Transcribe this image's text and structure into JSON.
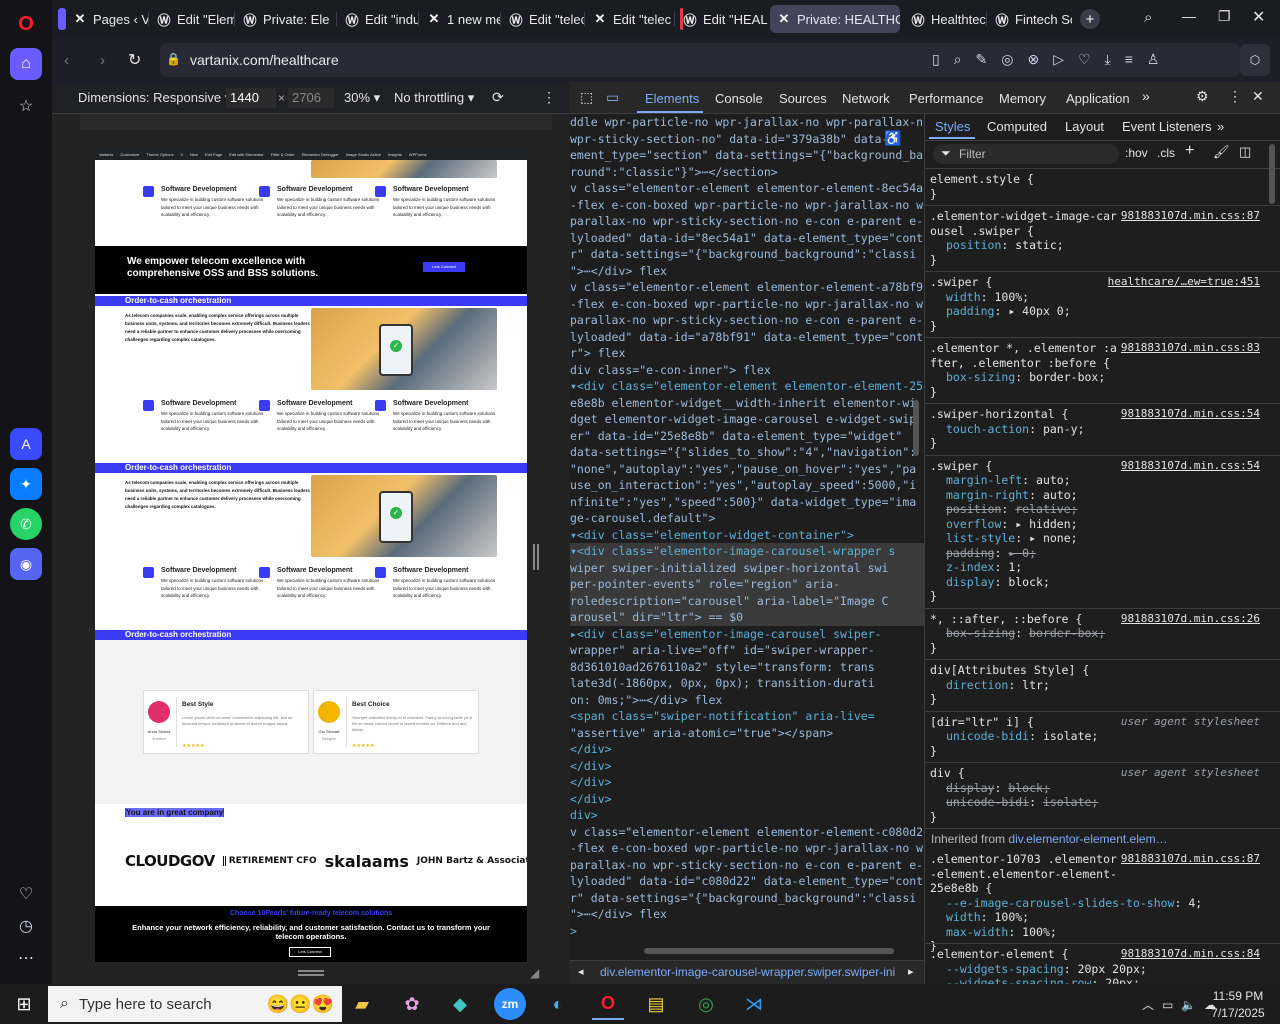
{
  "browser": {
    "tabs": [
      {
        "label": "Pages ‹ Va",
        "icon": "x-icon"
      },
      {
        "label": "Edit \"Elem",
        "icon": "wordpress-icon"
      },
      {
        "label": "Private: Ele",
        "icon": "wordpress-icon"
      },
      {
        "label": "Edit \"indus",
        "icon": "wordpress-icon"
      },
      {
        "label": "1 new mes",
        "icon": "x-icon"
      },
      {
        "label": "Edit \"telec",
        "icon": "wordpress-icon"
      },
      {
        "label": "Edit \"telec",
        "icon": "x-icon"
      },
      {
        "label": "Edit \"HEAL",
        "icon": "wordpress-icon"
      },
      {
        "label": "Private: HEALTHC/",
        "icon": "x-icon"
      },
      {
        "label": "Healthtech",
        "icon": "wordpress-icon"
      },
      {
        "label": "Fintech So",
        "icon": "wordpress-icon"
      }
    ],
    "url": "vartanix.com/healthcare"
  },
  "device_toolbar": {
    "dimensions_label": "Dimensions: Responsive",
    "width": "1440",
    "height": "2706",
    "zoom": "30%",
    "throttling": "No throttling"
  },
  "devtools_tabs": [
    "Elements",
    "Console",
    "Sources",
    "Network",
    "Performance",
    "Memory",
    "Application"
  ],
  "styles_tabs": [
    "Styles",
    "Computed",
    "Layout",
    "Event Listeners"
  ],
  "filter": {
    "placeholder": "Filter",
    "hov": ":hov",
    "cls": ".cls"
  },
  "elements_lines": [
    "ddle wpr-particle-no wpr-jarallax-no wpr-parallax-n",
    "wpr-sticky-section-no\" data-id=\"379a38b\" data-",
    "ement_type=\"section\" data-settings=\"{\"background_bac",
    "round\":\"classic\"}\">⋯</section>",
    "v class=\"elementor-element elementor-element-8ec54a",
    "-flex e-con-boxed wpr-particle-no wpr-jarallax-no w",
    "parallax-no wpr-sticky-section-no e-con e-parent e-",
    "lyloaded\" data-id=\"8ec54a1\" data-element_type=\"conta",
    "r\" data-settings=\"{\"background_background\":\"classi",
    "\">⋯</div> flex",
    "v class=\"elementor-element elementor-element-a78bf9",
    "-flex e-con-boxed wpr-particle-no wpr-jarallax-no w",
    "parallax-no wpr-sticky-section-no e-con e-parent e-",
    "lyloaded\" data-id=\"a78bf91\" data-element_type=\"conta",
    "r\"> flex",
    "div class=\"e-con-inner\"> flex",
    "▾<div class=\"elementor-element elementor-element-25",
    " e8e8b elementor-widget__width-inherit elementor-wi",
    " dget elementor-widget-image-carousel e-widget-swip",
    " er\" data-id=\"25e8e8b\" data-element_type=\"widget\"",
    " data-settings=\"{\"slides_to_show\":\"4\",\"navigation\":",
    " \"none\",\"autoplay\":\"yes\",\"pause_on_hover\":\"yes\",\"pa",
    " use_on_interaction\":\"yes\",\"autoplay_speed\":5000,\"i",
    " nfinite\":\"yes\",\"speed\":500}\" data-widget_type=\"ima",
    " ge-carousel.default\">",
    "  ▾<div class=\"elementor-widget-container\">",
    "   ▾<div class=\"elementor-image-carousel-wrapper s",
    "    wiper swiper-initialized swiper-horizontal swi",
    "    per-pointer-events\" role=\"region\" aria-",
    "    roledescription=\"carousel\" aria-label=\"Image C",
    "    arousel\" dir=\"ltr\"> == $0",
    "     ▸<div class=\"elementor-image-carousel swiper-",
    "      wrapper\" aria-live=\"off\" id=\"swiper-wrapper-",
    "      8d361010ad2676110a2\" style=\"transform: trans",
    "      late3d(-1860px, 0px, 0px); transition-durati",
    "      on: 0ms;\">⋯</div> flex",
    "      <span class=\"swiper-notification\" aria-live=",
    "      \"assertive\" aria-atomic=\"true\"></span>",
    "     </div>",
    "   </div>",
    "  </div>",
    " </div>",
    "div>",
    "v class=\"elementor-element elementor-element-c080d2",
    "-flex e-con-boxed wpr-particle-no wpr-jarallax-no w",
    "parallax-no wpr-sticky-section-no e-con e-parent e-",
    "lyloaded\" data-id=\"c080d22\" data-element_type=\"conta",
    "r\" data-settings=\"{\"background_background\":\"classi",
    "\">⋯</div> flex",
    ">"
  ],
  "breadcrumb": "div.elementor-image-carousel-wrapper.swiper.swiper-ini",
  "styles_rules": [
    {
      "sel": "element.style {",
      "src": "",
      "props": []
    },
    {
      "sel": ".elementor-widget-image-carousel .swiper {",
      "src": "981883107d.min.css:87",
      "props": [
        [
          "position",
          "static;"
        ]
      ]
    },
    {
      "sel": ".swiper {",
      "src": "healthcare/…ew=true:451",
      "props": [
        [
          "width",
          "100%;"
        ],
        [
          "padding",
          "▸ 40px 0;"
        ]
      ]
    },
    {
      "sel": ".elementor *, .elementor :after, .elementor :before {",
      "src": "981883107d.min.css:83",
      "props": [
        [
          "box-sizing",
          "border-box;"
        ]
      ]
    },
    {
      "sel": ".swiper-horizontal {",
      "src": "981883107d.min.css:54",
      "props": [
        [
          "touch-action",
          "pan-y;"
        ]
      ]
    },
    {
      "sel": ".swiper {",
      "src": "981883107d.min.css:54",
      "props": [
        [
          "margin-left",
          "auto;"
        ],
        [
          "margin-right",
          "auto;"
        ],
        [
          "position",
          "relative;"
        ],
        [
          "overflow",
          "▸ hidden;"
        ],
        [
          "list-style",
          "▸ none;"
        ],
        [
          "padding",
          "▸ 0;"
        ],
        [
          "z-index",
          "1;"
        ],
        [
          "display",
          "block;"
        ]
      ]
    },
    {
      "sel": "*, ::after, ::before {",
      "src": "981883107d.min.css:26",
      "props": [
        [
          "box-sizing",
          "border-box;"
        ]
      ]
    },
    {
      "sel": "div[Attributes Style] {",
      "src": "",
      "props": [
        [
          "direction",
          "ltr;"
        ]
      ]
    },
    {
      "sel": "[dir=\"ltr\" i] {",
      "src": "user agent stylesheet",
      "props": [
        [
          "unicode-bidi",
          "isolate;"
        ]
      ]
    },
    {
      "sel": "div {",
      "src": "user agent stylesheet",
      "props": [
        [
          "display",
          "block;"
        ],
        [
          "unicode-bidi",
          "isolate;"
        ]
      ]
    }
  ],
  "inherited_label": "Inherited from",
  "inherited_from": "div.elementor-element.elem…",
  "inherited_rules": [
    {
      "sel": ".elementor-10703 .elementor-element.elementor-element-25e8e8b {",
      "src": "981883107d.min.css:87",
      "props": [
        [
          "--e-image-carousel-slides-to-show",
          "4;"
        ],
        [
          "width",
          "100%;"
        ],
        [
          "max-width",
          "100%;"
        ]
      ]
    },
    {
      "sel": ".elementor-element {",
      "src": "981883107d.min.css:84",
      "props": [
        [
          "--widgets-spacing",
          "20px 20px;"
        ],
        [
          "--widgets-spacing-row",
          "20px;"
        ]
      ]
    }
  ],
  "site": {
    "service_title": "Software Development",
    "service_desc": "We specialize in building custom software solutions tailored to meet your unique business needs with scalability and efficiency.",
    "cta_heading": "We empower telecom excellence with comprehensive OSS and BSS solutions.",
    "cta_button": "Lets Connect",
    "band_title": "Order-to-cash orchestration",
    "band_desc": "As telecom companies scale, enabling complex service offerings across multiple business units, systems, and territories becomes extremely difficult. Business leaders need a reliable partner to enhance customer delivery processes while overcoming challenges regarding complex catalogues.",
    "testimonials": [
      {
        "title": "Best Style",
        "name": "Anna Stokes",
        "role": "Architect",
        "text": "Lorem ipsum dolor sit amet, consectetur adipiscing elit, sed do eiusmod tempor incididunt ut labore et dolore magna aliqua."
      },
      {
        "title": "Best Choice",
        "name": "Gia Stewart",
        "role": "Designer",
        "text": "Stronger unbridled felicity to of mistaken. Fanny at wrong table ye in. Be on easily cannot innate in lasted months on. Differed and and felicity."
      }
    ],
    "company_heading": "You are in great company",
    "logos": [
      "CLOUDGOV",
      "RETIREMENT CFO",
      "skalaams",
      "JOHN Bartz & Associates"
    ],
    "footer_kicker": "Choose 10Pearls' future-ready telecom solutions",
    "footer_heading": "Enhance your network efficiency, reliability, and customer satisfaction. Contact us to transform your telecom operations.",
    "footer_button": "Lets Connect",
    "admin_bar": [
      "Vartanix",
      "Customize",
      "Theme Options",
      "0",
      "New",
      "Edit Page",
      "Edit with Elementor",
      "Filter & Order",
      "Elementor Debugger",
      "Image Studio Active",
      "Insights",
      "WPForms"
    ]
  },
  "taskbar": {
    "search_placeholder": "Type here to search",
    "time": "11:59 PM",
    "date": "7/17/2025"
  }
}
